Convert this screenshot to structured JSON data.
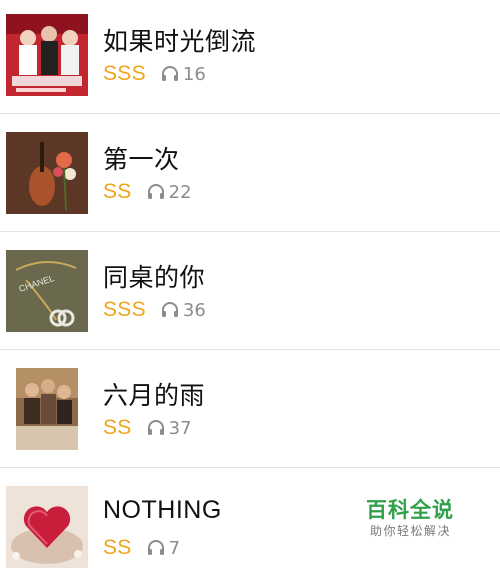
{
  "songs": [
    {
      "title": "如果时光倒流",
      "grade": "SSS",
      "listen_count": "16",
      "cover_icon": "album-cover-drama-poster"
    },
    {
      "title": "第一次",
      "grade": "SS",
      "listen_count": "22",
      "cover_icon": "album-cover-violin-flowers"
    },
    {
      "title": "同桌的你",
      "grade": "SSS",
      "listen_count": "36",
      "cover_icon": "album-cover-chanel-necklace"
    },
    {
      "title": "六月的雨",
      "grade": "SS",
      "listen_count": "37",
      "cover_icon": "album-cover-drama-cast"
    },
    {
      "title": "NOTHING",
      "grade": "SS",
      "listen_count": "7",
      "cover_icon": "album-cover-heart-cake"
    }
  ],
  "icons": {
    "listen": "headphones-icon"
  },
  "colors": {
    "grade": "#f0a41c",
    "listen_count": "#8c8c8c",
    "divider": "#e3e3e3",
    "watermark_green": "#2fa14a"
  },
  "watermark": {
    "title": "百科全说",
    "subtitle": "助你轻松解决"
  }
}
